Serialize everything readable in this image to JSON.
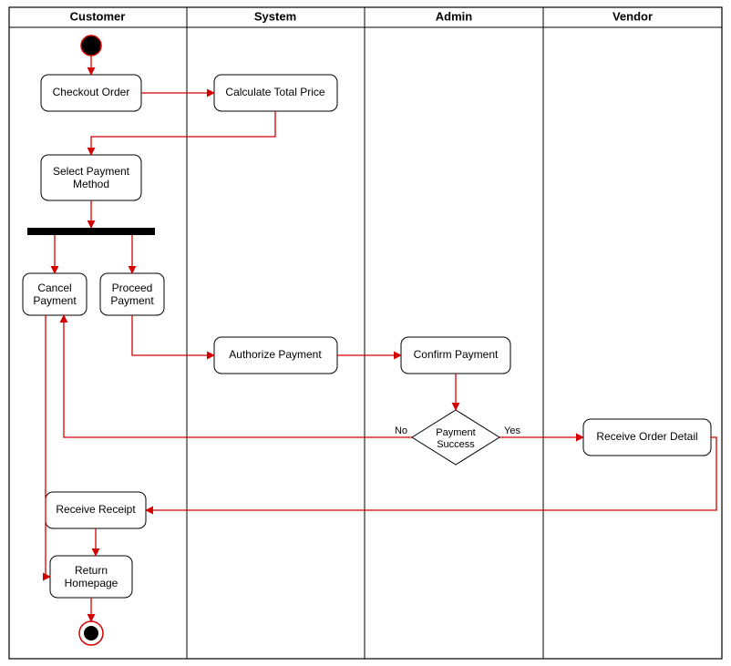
{
  "chart_data": {
    "type": "uml-activity-diagram",
    "title": "",
    "lanes": [
      "Customer",
      "System",
      "Admin",
      "Vendor"
    ],
    "nodes": [
      {
        "id": "start",
        "type": "start",
        "lane": "Customer"
      },
      {
        "id": "checkout",
        "type": "activity",
        "lane": "Customer",
        "label": "Checkout Order"
      },
      {
        "id": "calc",
        "type": "activity",
        "lane": "System",
        "label": "Calculate Total Price"
      },
      {
        "id": "select",
        "type": "activity",
        "lane": "Customer",
        "label": "Select Payment Method"
      },
      {
        "id": "fork",
        "type": "fork",
        "lane": "Customer"
      },
      {
        "id": "cancel",
        "type": "activity",
        "lane": "Customer",
        "label": "Cancel Payment"
      },
      {
        "id": "proceed",
        "type": "activity",
        "lane": "Customer",
        "label": "Proceed Payment"
      },
      {
        "id": "authorize",
        "type": "activity",
        "lane": "System",
        "label": "Authorize Payment"
      },
      {
        "id": "confirm",
        "type": "activity",
        "lane": "Admin",
        "label": "Confirm Payment"
      },
      {
        "id": "decision",
        "type": "decision",
        "lane": "Admin",
        "label": "Payment Success"
      },
      {
        "id": "receiveOrder",
        "type": "activity",
        "lane": "Vendor",
        "label": "Receive Order Detail"
      },
      {
        "id": "receipt",
        "type": "activity",
        "lane": "Customer",
        "label": "Receive Receipt"
      },
      {
        "id": "return",
        "type": "activity",
        "lane": "Customer",
        "label": "Return Homepage"
      },
      {
        "id": "end",
        "type": "end",
        "lane": "Customer"
      }
    ],
    "edges": [
      {
        "from": "start",
        "to": "checkout"
      },
      {
        "from": "checkout",
        "to": "calc"
      },
      {
        "from": "calc",
        "to": "select"
      },
      {
        "from": "select",
        "to": "fork"
      },
      {
        "from": "fork",
        "to": "cancel"
      },
      {
        "from": "fork",
        "to": "proceed"
      },
      {
        "from": "proceed",
        "to": "authorize"
      },
      {
        "from": "authorize",
        "to": "confirm"
      },
      {
        "from": "confirm",
        "to": "decision"
      },
      {
        "from": "decision",
        "to": "cancel",
        "label": "No"
      },
      {
        "from": "decision",
        "to": "receiveOrder",
        "label": "Yes"
      },
      {
        "from": "receiveOrder",
        "to": "receipt"
      },
      {
        "from": "receipt",
        "to": "return"
      },
      {
        "from": "cancel",
        "to": "return"
      },
      {
        "from": "return",
        "to": "end"
      }
    ]
  },
  "lanes": {
    "customer": "Customer",
    "system": "System",
    "admin": "Admin",
    "vendor": "Vendor"
  },
  "nodes": {
    "checkout": "Checkout Order",
    "calc": "Calculate Total Price",
    "select_l1": "Select Payment",
    "select_l2": "Method",
    "cancel_l1": "Cancel",
    "cancel_l2": "Payment",
    "proceed_l1": "Proceed",
    "proceed_l2": "Payment",
    "authorize": "Authorize Payment",
    "confirm": "Confirm Payment",
    "decision_l1": "Payment",
    "decision_l2": "Success",
    "receiveOrder": "Receive Order Detail",
    "receipt": "Receive Receipt",
    "return_l1": "Return",
    "return_l2": "Homepage"
  },
  "edgeLabels": {
    "no": "No",
    "yes": "Yes"
  }
}
